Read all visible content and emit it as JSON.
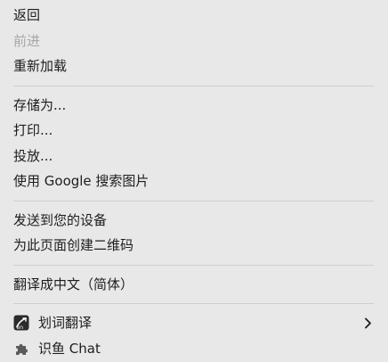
{
  "menu": {
    "back": "返回",
    "forward": "前进",
    "reload": "重新加载",
    "save_as": "存储为...",
    "print": "打印...",
    "cast": "投放...",
    "search_image": "使用 Google 搜索图片",
    "send_to_devices": "发送到您的设备",
    "create_qr": "为此页面创建二维码",
    "translate": "翻译成中文（简体）",
    "word_translate": "划词翻译",
    "shiyu_chat": "识鱼 Chat"
  },
  "icons": {
    "word_translate": "translate-extension-icon",
    "shiyu_chat": "puzzle-piece-icon",
    "submenu": "chevron-right-icon"
  },
  "colors": {
    "background": "#e8e8e8",
    "text": "#1d1d1f",
    "disabled_text": "#a7a7aa",
    "separator": "#cfcfd0"
  }
}
